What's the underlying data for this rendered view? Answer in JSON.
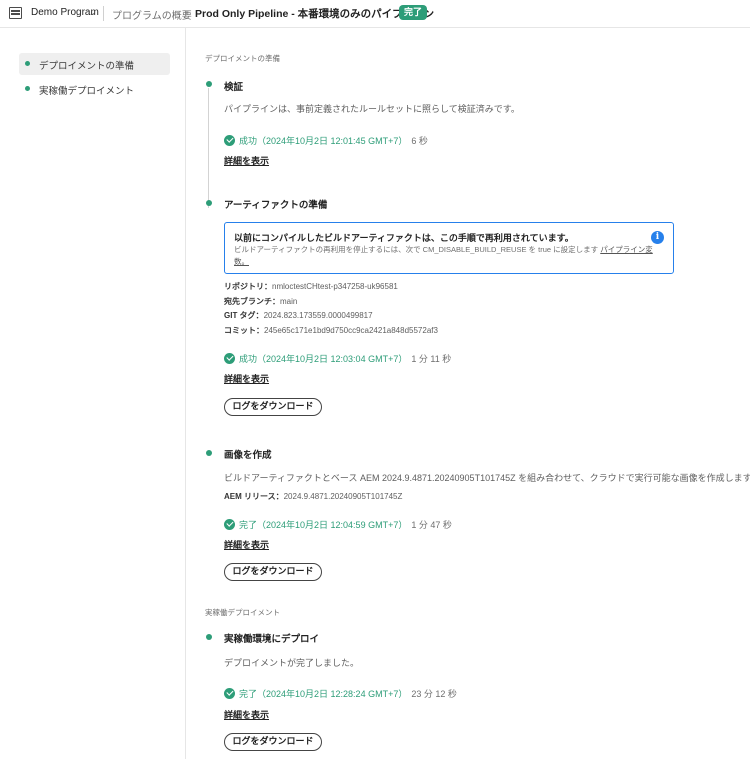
{
  "header": {
    "program_name": "Demo Program",
    "breadcrumb": "プログラムの概要",
    "title": "Prod Only Pipeline - 本番環境のみのパイプライン",
    "status": "完了"
  },
  "sidebar": {
    "items": [
      {
        "label": "デプロイメントの準備",
        "active": true
      },
      {
        "label": "実稼働デプロイメント",
        "active": false
      }
    ]
  },
  "sections": {
    "prep_title": "デプロイメントの準備",
    "prod_title": "実稼働デプロイメント"
  },
  "steps": {
    "validation": {
      "title": "検証",
      "description": "パイプラインは、事前定義されたルールセットに照らして検証済みです。",
      "status": "成功（2024年10月2日 12:01:45 GMT+7）",
      "duration": "6 秒",
      "details_label": "詳細を表示"
    },
    "artifact": {
      "title": "アーティファクトの準備",
      "info_title": "以前にコンパイルしたビルドアーティファクトは、この手順で再利用されています。",
      "info_body": "ビルドアーティファクトの再利用を停止するには、次で CM_DISABLE_BUILD_REUSE を true に設定します",
      "info_link": "パイプライン変数。",
      "repo_key": "リポジトリ：",
      "repo_value": "nmloctestCHtest-p347258-uk96581",
      "branch_key": "宛先ブランチ：",
      "branch_value": "main",
      "tag_key": "GIT タグ：",
      "tag_value": "2024.823.173559.0000499817",
      "commit_key": "コミット：",
      "commit_value": "245e65c171e1bd9d750cc9ca2421a848d5572af3",
      "status": "成功（2024年10月2日 12:03:04 GMT+7）",
      "duration": "1 分 11 秒",
      "details_label": "詳細を表示",
      "log_label": "ログをダウンロード"
    },
    "image": {
      "title": "画像を作成",
      "description": "ビルドアーティファクトとベース AEM 2024.9.4871.20240905T101745Z を組み合わせて、クラウドで実行可能な画像を作成します。",
      "release_key": "AEM リリース：",
      "release_value": "2024.9.4871.20240905T101745Z",
      "status": "完了（2024年10月2日 12:04:59 GMT+7）",
      "duration": "1 分 47 秒",
      "details_label": "詳細を表示",
      "log_label": "ログをダウンロード"
    },
    "deploy": {
      "title": "実稼働環境にデプロイ",
      "description": "デプロイメントが完了しました。",
      "status": "完了（2024年10月2日 12:28:24 GMT+7）",
      "duration": "23 分 12 秒",
      "details_label": "詳細を表示",
      "log_label": "ログをダウンロード"
    }
  },
  "colors": {
    "success": "#2d9d78",
    "info": "#2680eb"
  }
}
